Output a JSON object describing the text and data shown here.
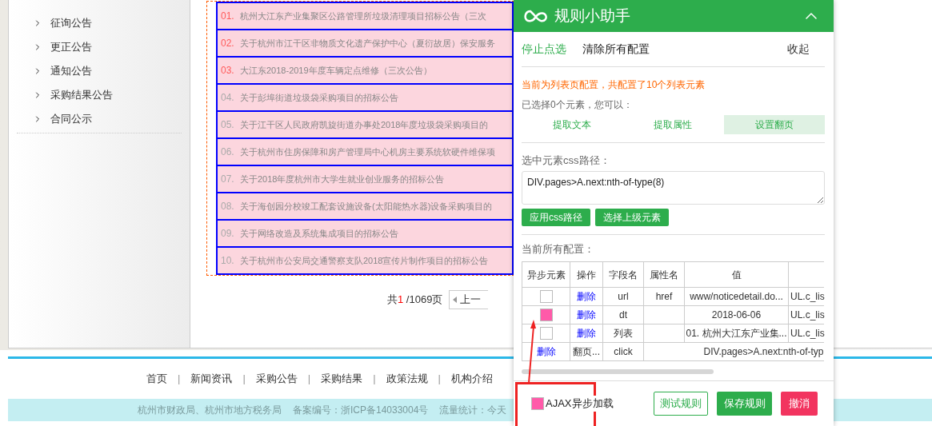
{
  "sidebar": {
    "items": [
      "征询公告",
      "更正公告",
      "通知公告",
      "采购结果公告",
      "合同公示"
    ]
  },
  "notice_list": {
    "items": [
      {
        "number": "01.",
        "title": "杭州大江东产业集聚区公路管理所垃圾清理项目招标公告（三次",
        "marked": true
      },
      {
        "number": "02.",
        "title": "关于杭州市江干区非物质文化遗产保护中心（夏衍故居）保安服务",
        "marked": true
      },
      {
        "number": "03.",
        "title": "大江东2018-2019年度车辆定点维修（三次公告）",
        "marked": true
      },
      {
        "number": "04.",
        "title": "关于彭埠街道垃圾袋采购项目的招标公告",
        "marked": false
      },
      {
        "number": "05.",
        "title": "关于江干区人民政府凯旋街道办事处2018年度垃圾袋采购项目的",
        "marked": false
      },
      {
        "number": "06.",
        "title": "关于杭州市住房保障和房产管理局中心机房主要系统软硬件维保项",
        "marked": false
      },
      {
        "number": "07.",
        "title": "关于2018年度杭州市大学生就业创业服务的招标公告",
        "marked": false
      },
      {
        "number": "08.",
        "title": "关于海创园分校竣工配套设施设备(太阳能热水器)设备采购项目的",
        "marked": false
      },
      {
        "number": "09.",
        "title": "关于网络改造及系统集成项目的招标公告",
        "marked": false
      },
      {
        "number": "10.",
        "title": "关于杭州市公安局交通警察支队2018宣传片制作项目的招标公告",
        "marked": false
      }
    ]
  },
  "pagination": {
    "prefix": "共",
    "current": "1",
    "total": "/1069页",
    "prev_button": "上一"
  },
  "footer": {
    "nav": [
      "首页",
      "新闻资讯",
      "采购公告",
      "采购结果",
      "政策法规",
      "机构介绍"
    ],
    "separator": "|",
    "info": [
      "杭州市财政局、杭州市地方税务局",
      "备案编号：浙ICP备14033004号",
      "流量统计：今天"
    ]
  },
  "helper_panel": {
    "title": "规则小助手",
    "actions": [
      {
        "label": "停止点选",
        "kind": "active"
      },
      {
        "label": "清除所有配置",
        "kind": "plain"
      }
    ],
    "collapse": "收起",
    "notice": "当前为列表页配置，共配置了10个列表元素",
    "selection_info": "已选择0个元素，您可以：",
    "modes": [
      {
        "label": "提取文本",
        "selected": false
      },
      {
        "label": "提取属性",
        "selected": false
      },
      {
        "label": "设置翻页",
        "selected": true
      }
    ],
    "css_path_label": "选中元素css路径：",
    "css_path": "DIV.pages>A.next:nth-of-type(8)",
    "path_buttons": [
      "应用css路径",
      "选择上级元素"
    ],
    "config_label": "当前所有配置：",
    "table": {
      "columns": [
        "异步元素",
        "操作",
        "字段名",
        "属性名",
        "值"
      ],
      "rows": [
        {
          "kind": "field",
          "async": false,
          "cells": [
            "",
            "删除",
            "url",
            "href",
            "www/noticedetail.do...",
            "UL.c_lis"
          ]
        },
        {
          "kind": "field",
          "async": true,
          "cells": [
            "",
            "删除",
            "dt",
            "",
            "2018-06-06",
            "UL.c_lis"
          ]
        },
        {
          "kind": "field",
          "async": false,
          "cells": [
            "",
            "删除",
            "列表",
            "",
            "01. 杭州大江东产业集...",
            "UL.c_lis"
          ]
        },
        {
          "kind": "pagination",
          "cells": [
            "删除",
            "翻页...",
            "click",
            "",
            {
              "text": "DIV.pages>A.next:nth-of-typ",
              "colspan": 2
            }
          ]
        }
      ]
    },
    "ajax": {
      "label": "AJAX异步加载",
      "checked": true
    },
    "buttons": [
      {
        "label": "测试规则",
        "kind": "outline"
      },
      {
        "label": "保存规则",
        "kind": "primary"
      },
      {
        "label": "撤消",
        "kind": "danger"
      }
    ]
  }
}
